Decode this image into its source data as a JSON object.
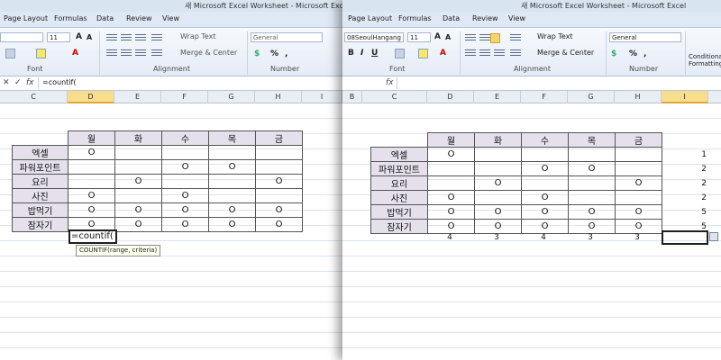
{
  "left": {
    "window_title": "새 Microsoft Excel Worksheet - Microsoft Excel",
    "tabs": [
      "Page Layout",
      "Formulas",
      "Data",
      "Review",
      "View"
    ],
    "font_size": "11",
    "wrap_text": "Wrap Text",
    "number_format": "General",
    "merge_center": "Merge & Center",
    "group_font": "Font",
    "group_alignment": "Alignment",
    "group_number": "Number",
    "formula_icons": {
      "cancel": "✕",
      "enter": "✓",
      "fx": "fx"
    },
    "formula_text": "=countif(",
    "columns": [
      "C",
      "D",
      "E",
      "F",
      "G",
      "H",
      "I"
    ],
    "active_column": "D",
    "cell_editor": "=countif(",
    "tooltip": "COUNTIF(range, criteria)"
  },
  "right": {
    "window_title": "새 Microsoft Excel Worksheet - Microsoft Excel",
    "tabs": [
      "Page Layout",
      "Formulas",
      "Data",
      "Review",
      "View"
    ],
    "font_name": "08SeoulHangang",
    "font_size": "11",
    "wrap_text": "Wrap Text",
    "number_format": "General",
    "merge_center": "Merge & Center",
    "group_font": "Font",
    "group_alignment": "Alignment",
    "group_number": "Number",
    "conditional_formatting": "Conditional Formatting",
    "fx": "fx",
    "columns": [
      "B",
      "C",
      "D",
      "E",
      "F",
      "G",
      "H",
      "I"
    ],
    "active_column": "I",
    "column_counts": [
      "4",
      "3",
      "4",
      "3",
      "3"
    ],
    "row_counts": [
      "1",
      "2",
      "2",
      "2",
      "5",
      "5"
    ]
  },
  "table": {
    "days": [
      "월",
      "화",
      "수",
      "목",
      "금"
    ],
    "rows": [
      {
        "label": "엑셀",
        "cells": [
          "O",
          "",
          "",
          "",
          ""
        ]
      },
      {
        "label": "파워포인트",
        "cells": [
          "",
          "",
          "O",
          "O",
          ""
        ]
      },
      {
        "label": "요리",
        "cells": [
          "",
          "O",
          "",
          "",
          "O"
        ]
      },
      {
        "label": "사진",
        "cells": [
          "O",
          "",
          "O",
          "",
          ""
        ]
      },
      {
        "label": "밥먹기",
        "cells": [
          "O",
          "O",
          "O",
          "O",
          "O"
        ]
      },
      {
        "label": "잠자기",
        "cells": [
          "O",
          "O",
          "O",
          "O",
          "O"
        ]
      }
    ]
  }
}
